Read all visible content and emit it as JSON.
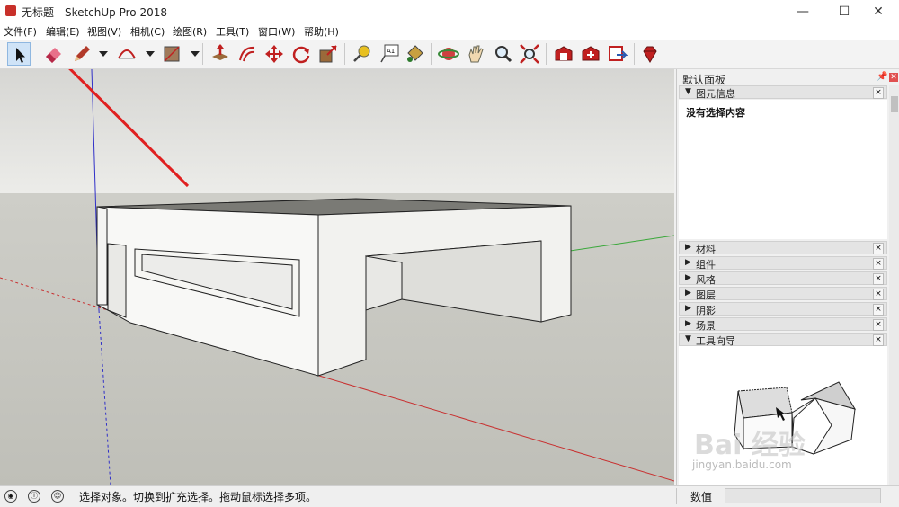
{
  "window": {
    "title": "无标题 - SketchUp Pro 2018",
    "min_glyph": "—",
    "max_glyph": "☐",
    "close_glyph": "✕"
  },
  "menu": [
    "文件(F)",
    "编辑(E)",
    "视图(V)",
    "相机(C)",
    "绘图(R)",
    "工具(T)",
    "窗口(W)",
    "帮助(H)"
  ],
  "toolbar": {
    "tools": [
      "select-icon",
      "eraser-icon",
      "pencil-icon",
      "arc-icon",
      "rectangle-icon",
      "push-pull-icon",
      "offset-icon",
      "move-icon",
      "rotate-icon",
      "scale-icon",
      "tape-measure-icon",
      "text-icon",
      "paint-bucket-icon",
      "orbit-icon",
      "pan-icon",
      "zoom-icon",
      "zoom-extents-icon",
      "warehouse-icon",
      "extension-icon",
      "share-icon",
      "ruby-icon"
    ],
    "text_tool_label": "A1"
  },
  "panel": {
    "title": "默认面板",
    "entity_info": {
      "label": "图元信息",
      "content": "没有选择内容"
    },
    "trays": [
      "材料",
      "组件",
      "风格",
      "图层",
      "阴影",
      "场景",
      "工具向导"
    ],
    "tray_close": "×",
    "collapsed_arrow": "▶",
    "expanded_arrow": "▼"
  },
  "statusbar": {
    "hint": "选择对象。切换到扩充选择。拖动鼠标选择多项。",
    "measure_label": "数值",
    "measure_value": ""
  },
  "watermark": {
    "text": "Bai 经验",
    "url": "jingyan.baidu.com"
  },
  "colors": {
    "sky": "#e8e8e6",
    "ground": "#cfcfc9",
    "model_face": "#fafaf8",
    "model_top": "#777772",
    "axis_red": "#c83030",
    "axis_green": "#3aa83a",
    "axis_blue": "#3030c8",
    "arrow": "#e02020"
  }
}
